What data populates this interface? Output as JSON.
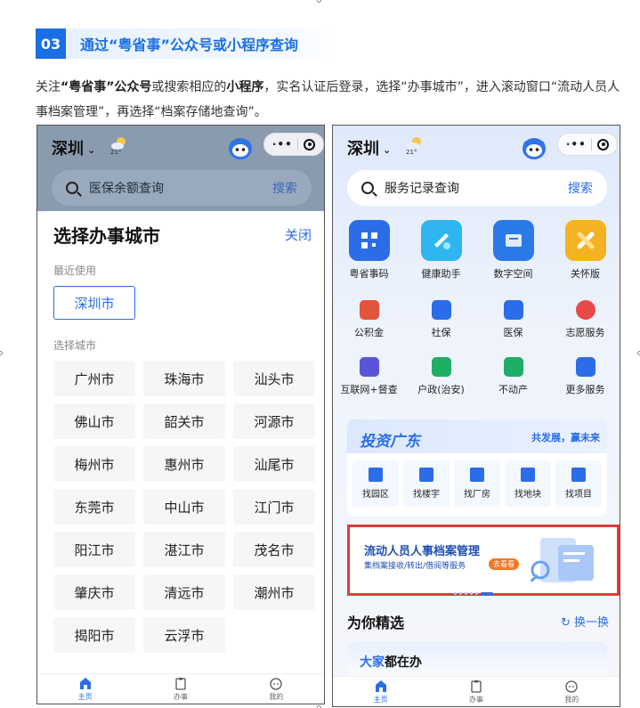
{
  "section": {
    "number": "03",
    "title": "通过“粤省事”公众号或小程序查询"
  },
  "paragraph": {
    "p1": "关注",
    "b1": "“粤省事”公众号",
    "p2": "或搜索相应的",
    "b2": "小程序",
    "p3": "，实名认证后登录，选择“办事城市”，进入滚动窗口“流动人员人事档案管理”，再选择“档案存储地查询”。"
  },
  "left_phone": {
    "city": "深圳",
    "temperature": "21°",
    "search_text": "医保余额查询",
    "search_button": "搜索",
    "modal": {
      "title": "选择办事城市",
      "close": "关闭",
      "recent_label": "最近使用",
      "recent_city": "深圳市",
      "choose_label": "选择城市",
      "cities": [
        "广州市",
        "珠海市",
        "汕头市",
        "佛山市",
        "韶关市",
        "河源市",
        "梅州市",
        "惠州市",
        "汕尾市",
        "东莞市",
        "中山市",
        "江门市",
        "阳江市",
        "湛江市",
        "茂名市",
        "肇庆市",
        "清远市",
        "潮州市",
        "揭阳市",
        "云浮市"
      ]
    },
    "tabs": [
      "主页",
      "办事",
      "我的"
    ]
  },
  "right_phone": {
    "city": "深圳",
    "temperature": "21°",
    "search_text": "服务记录查询",
    "search_button": "搜索",
    "services_top": [
      {
        "label": "粤省事码",
        "color": "#2b6de8"
      },
      {
        "label": "健康助手",
        "color": "#2fb6f0"
      },
      {
        "label": "数字空间",
        "color": "#2a7be8"
      },
      {
        "label": "关怀版",
        "color": "#f5b323"
      }
    ],
    "services": [
      {
        "label": "公积金",
        "color": "#e2553b"
      },
      {
        "label": "社保",
        "color": "#2b6de8"
      },
      {
        "label": "医保",
        "color": "#2b6de8"
      },
      {
        "label": "志愿服务",
        "color": "#e84a4a"
      },
      {
        "label": "互联网+督查",
        "color": "#5a55d8"
      },
      {
        "label": "户政(治安)",
        "color": "#1fae66"
      },
      {
        "label": "不动产",
        "color": "#1fae66"
      },
      {
        "label": "更多服务",
        "color": "#2b6de8"
      }
    ],
    "invest": {
      "title": "投资广东",
      "slogan": "共发展，赢未来",
      "items": [
        "找园区",
        "找楼宇",
        "找厂房",
        "找地块",
        "找项目"
      ]
    },
    "banner": {
      "title": "流动人员人事档案管理",
      "subtitle": "集档案接收/转出/借阅等服务",
      "go": "去看看"
    },
    "for_you": "为你精选",
    "refresh": "换一换",
    "dajia": {
      "a": "大家",
      "b": "都在办"
    },
    "tabs": [
      "主页",
      "办事",
      "我的"
    ]
  }
}
